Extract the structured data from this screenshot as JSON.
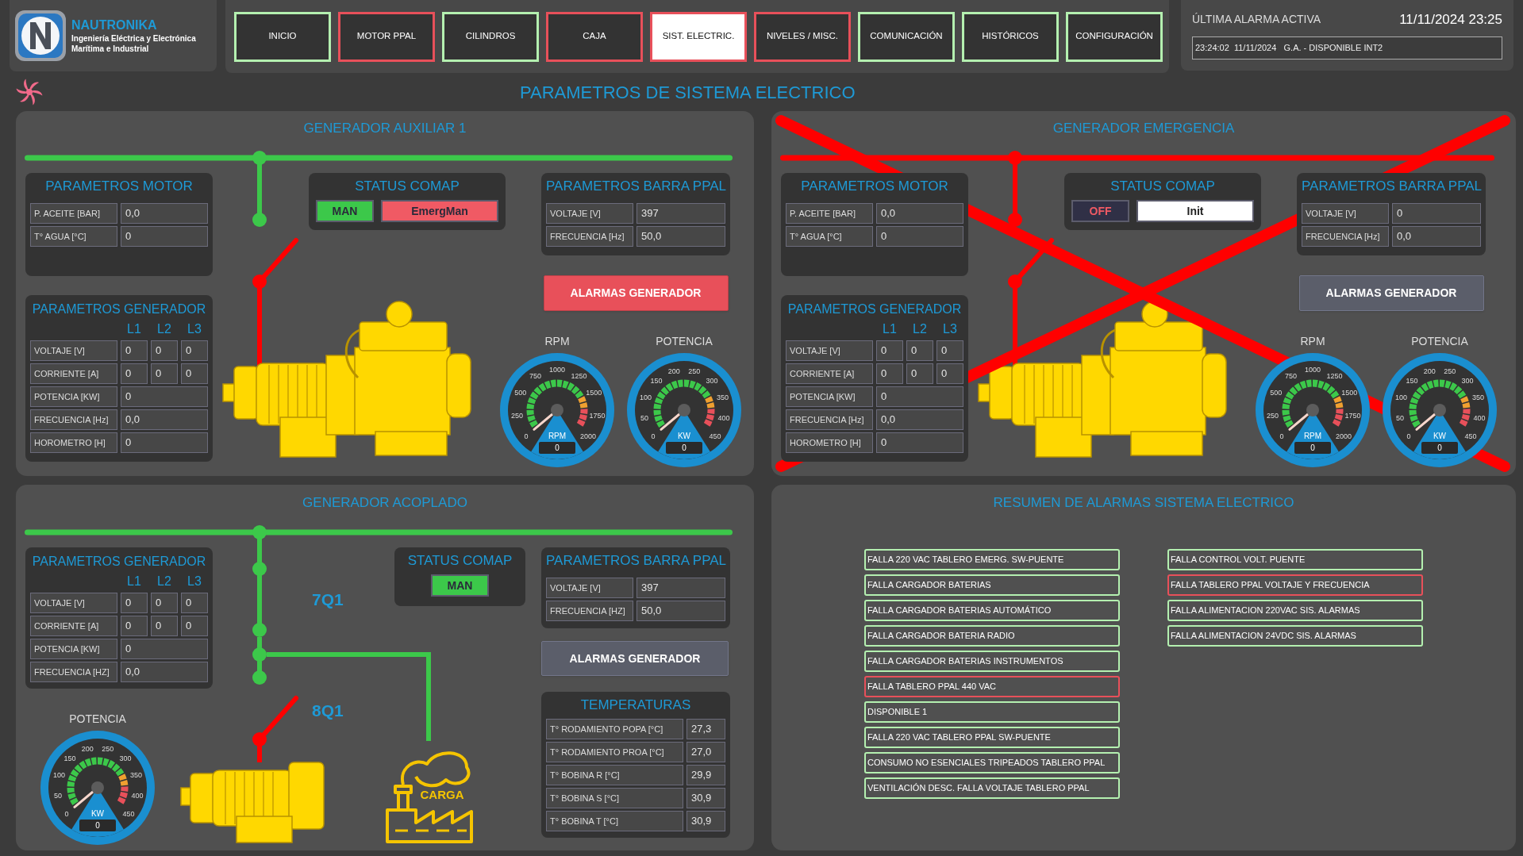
{
  "header": {
    "brand": "NAUTRONIKA",
    "tagline_1": "Ingeniería Eléctrica y Electrónica",
    "tagline_2": "Marítima e Industrial"
  },
  "nav_tabs": [
    {
      "label": "INICIO",
      "selected": false,
      "alarm": false
    },
    {
      "label": "MOTOR PPAL",
      "selected": false,
      "alarm": true
    },
    {
      "label": "CILINDROS",
      "selected": false,
      "alarm": false
    },
    {
      "label": "CAJA",
      "selected": false,
      "alarm": true
    },
    {
      "label": "SIST. ELECTRIC.",
      "selected": true,
      "alarm": true
    },
    {
      "label": "NIVELES / MISC.",
      "selected": false,
      "alarm": true
    },
    {
      "label": "COMUNICACIÓN",
      "selected": false,
      "alarm": false
    },
    {
      "label": "HISTÓRICOS",
      "selected": false,
      "alarm": false
    },
    {
      "label": "CONFIGURACIÓN",
      "selected": false,
      "alarm": false
    }
  ],
  "last_alarm": {
    "title": "ÚLTIMA ALARMA ACTIVA",
    "datetime": "11/11/2024 23:25",
    "entry": "23:24:02  11/11/2024   G.A. - DISPONIBLE INT2"
  },
  "page_title": "PARAMETROS DE SISTEMA ELECTRICO",
  "generators": [
    {
      "title": "GENERADOR AUXILIAR 1",
      "crossed_out": false,
      "bus_energized": true,
      "breaker_closed": false,
      "motor_params": {
        "title": "PARAMETROS MOTOR",
        "rows": [
          {
            "label": "P. ACEITE [BAR]",
            "value": "0,0"
          },
          {
            "label": "T° AGUA [°C]",
            "value": "0"
          }
        ]
      },
      "status": {
        "title": "STATUS COMAP",
        "badges": [
          {
            "label": "MAN",
            "kind": "ok"
          },
          {
            "label": "EmergMan",
            "kind": "alarm"
          }
        ]
      },
      "bus_params": {
        "title": "PARAMETROS BARRA PPAL",
        "rows": [
          {
            "label": "VOLTAJE [V]",
            "value": "397"
          },
          {
            "label": "FRECUENCIA [Hz]",
            "value": "50,0"
          }
        ]
      },
      "alarm_button": {
        "label": "ALARMAS GENERADOR",
        "alarm": true
      },
      "gen_params": {
        "title": "PARAMETROS GENERADOR",
        "phases": [
          "L1",
          "L2",
          "L3"
        ],
        "rows": [
          {
            "label": "VOLTAJE [V]",
            "values": [
              "0",
              "0",
              "0"
            ]
          },
          {
            "label": "CORRIENTE [A]",
            "values": [
              "0",
              "0",
              "0"
            ]
          },
          {
            "label": "POTENCIA [KW]",
            "values": [
              "0"
            ]
          },
          {
            "label": "FRECUENCIA [Hz]",
            "values": [
              "0,0"
            ]
          },
          {
            "label": "HOROMETRO [H]",
            "values": [
              "0"
            ]
          }
        ]
      },
      "gauges": [
        {
          "title": "RPM",
          "unit": "RPM",
          "reading": "0",
          "ticks": [
            "0",
            "250",
            "500",
            "750",
            "1000",
            "1250",
            "1500",
            "1750",
            "2000"
          ]
        },
        {
          "title": "POTENCIA",
          "unit": "KW",
          "reading": "0",
          "ticks": [
            "0",
            "50",
            "100",
            "150",
            "200",
            "250",
            "300",
            "350",
            "400",
            "450"
          ]
        }
      ]
    },
    {
      "title": "GENERADOR EMERGENCIA",
      "crossed_out": true,
      "bus_energized": false,
      "breaker_closed": false,
      "motor_params": {
        "title": "PARAMETROS MOTOR",
        "rows": [
          {
            "label": "P. ACEITE [BAR]",
            "value": "0,0"
          },
          {
            "label": "T° AGUA [°C]",
            "value": "0"
          }
        ]
      },
      "status": {
        "title": "STATUS COMAP",
        "badges": [
          {
            "label": "OFF",
            "kind": "off"
          },
          {
            "label": "Init",
            "kind": "info"
          }
        ]
      },
      "bus_params": {
        "title": "PARAMETROS BARRA PPAL",
        "rows": [
          {
            "label": "VOLTAJE [V]",
            "value": "0"
          },
          {
            "label": "FRECUENCIA [Hz]",
            "value": "0,0"
          }
        ]
      },
      "alarm_button": {
        "label": "ALARMAS GENERADOR",
        "alarm": false
      },
      "gen_params": {
        "title": "PARAMETROS GENERADOR",
        "phases": [
          "L1",
          "L2",
          "L3"
        ],
        "rows": [
          {
            "label": "VOLTAJE [V]",
            "values": [
              "0",
              "0",
              "0"
            ]
          },
          {
            "label": "CORRIENTE [A]",
            "values": [
              "0",
              "0",
              "0"
            ]
          },
          {
            "label": "POTENCIA [KW]",
            "values": [
              "0"
            ]
          },
          {
            "label": "FRECUENCIA [Hz]",
            "values": [
              "0,0"
            ]
          },
          {
            "label": "HOROMETRO [H]",
            "values": [
              "0"
            ]
          }
        ]
      },
      "gauges": [
        {
          "title": "RPM",
          "unit": "RPM",
          "reading": "0",
          "ticks": [
            "0",
            "250",
            "500",
            "750",
            "1000",
            "1250",
            "1500",
            "1750",
            "2000"
          ]
        },
        {
          "title": "POTENCIA",
          "unit": "KW",
          "reading": "0",
          "ticks": [
            "0",
            "50",
            "100",
            "150",
            "200",
            "250",
            "300",
            "350",
            "400",
            "450"
          ]
        }
      ]
    }
  ],
  "coupled_generator": {
    "title": "GENERADOR ACOPLADO",
    "bus_energized": true,
    "breakers": [
      {
        "label": "7Q1",
        "closed": true
      },
      {
        "label": "8Q1",
        "closed": false
      }
    ],
    "load_label": "CARGA",
    "gen_params": {
      "title": "PARAMETROS GENERADOR",
      "phases": [
        "L1",
        "L2",
        "L3"
      ],
      "rows": [
        {
          "label": "VOLTAJE [V]",
          "values": [
            "0",
            "0",
            "0"
          ]
        },
        {
          "label": "CORRIENTE [A]",
          "values": [
            "0",
            "0",
            "0"
          ]
        },
        {
          "label": "POTENCIA [KW]",
          "values": [
            "0"
          ]
        },
        {
          "label": "FRECUENCIA [HZ]",
          "values": [
            "0,0"
          ]
        }
      ]
    },
    "gauge": {
      "title": "POTENCIA",
      "unit": "KW",
      "reading": "0",
      "ticks": [
        "0",
        "50",
        "100",
        "150",
        "200",
        "250",
        "300",
        "350",
        "400",
        "450"
      ]
    },
    "status": {
      "title": "STATUS COMAP",
      "badges": [
        {
          "label": "MAN",
          "kind": "ok"
        }
      ]
    },
    "bus_params": {
      "title": "PARAMETROS BARRA PPAL",
      "rows": [
        {
          "label": "VOLTAJE [V]",
          "value": "397"
        },
        {
          "label": "FRECUENCIA [HZ]",
          "value": "50,0"
        }
      ]
    },
    "alarm_button": {
      "label": "ALARMAS GENERADOR",
      "alarm": false
    },
    "temperatures": {
      "title": "TEMPERATURAS",
      "rows": [
        {
          "label": "T° RODAMIENTO POPA [°C]",
          "value": "27,3"
        },
        {
          "label": "T° RODAMIENTO PROA [°C]",
          "value": "27,0"
        },
        {
          "label": "T° BOBINA R [°C]",
          "value": "29,9"
        },
        {
          "label": "T° BOBINA S [°C]",
          "value": "30,9"
        },
        {
          "label": "T° BOBINA T [°C]",
          "value": "30,9"
        }
      ]
    }
  },
  "alarm_summary": {
    "title": "RESUMEN DE ALARMAS SISTEMA ELECTRICO",
    "columns": [
      [
        {
          "label": "FALLA 220 VAC TABLERO EMERG. SW-PUENTE",
          "alarm": false
        },
        {
          "label": "FALLA CARGADOR BATERIAS",
          "alarm": false
        },
        {
          "label": "FALLA CARGADOR BATERIAS AUTOMÁTICO",
          "alarm": false
        },
        {
          "label": "FALLA CARGADOR BATERIA RADIO",
          "alarm": false
        },
        {
          "label": "FALLA CARGADOR BATERIAS INSTRUMENTOS",
          "alarm": false
        },
        {
          "label": "FALLA TABLERO PPAL 440 VAC",
          "alarm": true
        },
        {
          "label": "DISPONIBLE 1",
          "alarm": false
        },
        {
          "label": "FALLA 220 VAC TABLERO PPAL SW-PUENTE",
          "alarm": false
        },
        {
          "label": "CONSUMO NO ESENCIALES TRIPEADOS TABLERO PPAL",
          "alarm": false
        },
        {
          "label": "VENTILACIÓN DESC. FALLA VOLTAJE TABLERO PPAL",
          "alarm": false
        }
      ],
      [
        {
          "label": "FALLA CONTROL VOLT. PUENTE",
          "alarm": false
        },
        {
          "label": "FALLA TABLERO PPAL VOLTAJE Y FRECUENCIA",
          "alarm": true
        },
        {
          "label": "FALLA ALIMENTACION 220VAC SIS. ALARMAS",
          "alarm": false
        },
        {
          "label": "FALLA ALIMENTACION 24VDC SIS. ALARMAS",
          "alarm": false
        }
      ]
    ]
  }
}
